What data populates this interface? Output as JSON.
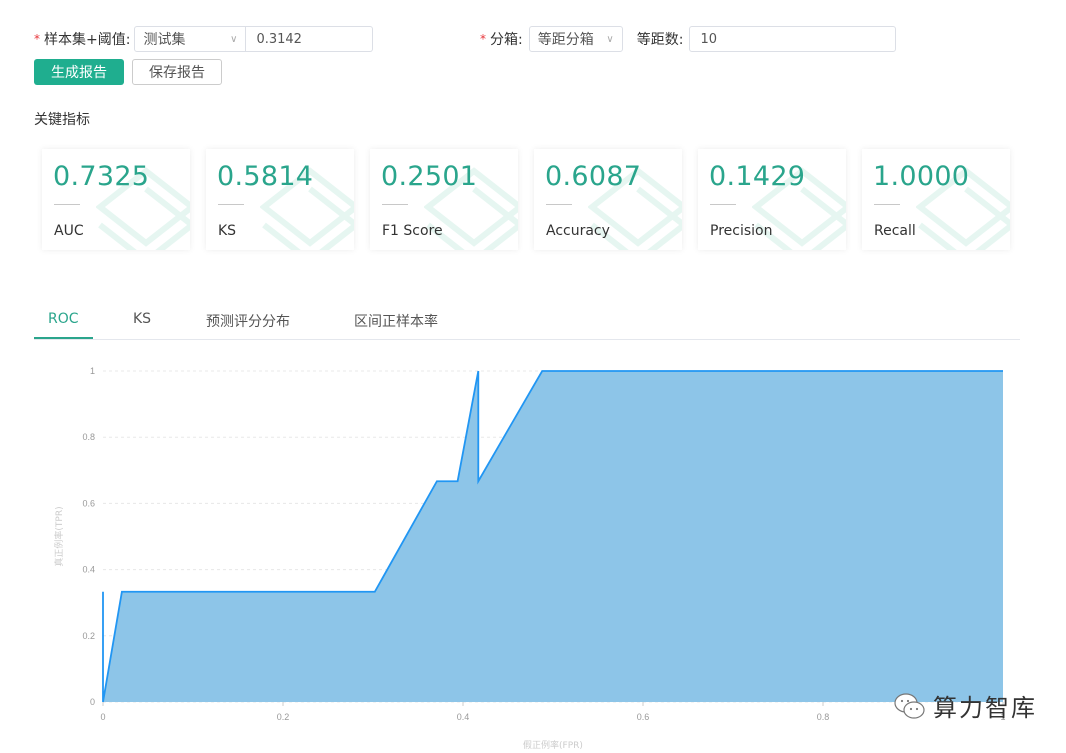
{
  "form": {
    "sample_label": "样本集+阈值:",
    "sample_select": "测试集",
    "threshold_value": "0.3142",
    "binning_label": "分箱:",
    "binning_select": "等距分箱",
    "bins_label": "等距数:",
    "bins_value": "10",
    "required_mark": "*"
  },
  "buttons": {
    "generate": "生成报告",
    "save": "保存报告"
  },
  "metrics_title": "关键指标",
  "metrics": [
    {
      "value": "0.7325",
      "name": "AUC"
    },
    {
      "value": "0.5814",
      "name": "KS"
    },
    {
      "value": "0.2501",
      "name": "F1 Score"
    },
    {
      "value": "0.6087",
      "name": "Accuracy"
    },
    {
      "value": "0.1429",
      "name": "Precision"
    },
    {
      "value": "1.0000",
      "name": "Recall"
    }
  ],
  "tabs": [
    {
      "label": "ROC",
      "active": true
    },
    {
      "label": "KS",
      "active": false
    },
    {
      "label": "预测评分分布",
      "active": false
    },
    {
      "label": "区间正样本率",
      "active": false
    }
  ],
  "colors": {
    "accent": "#2aa58c",
    "primary_button": "#1fae8f",
    "area_fill": "#8dc5e8",
    "line": "#2196f3"
  },
  "watermark": "算力智库",
  "chart_data": {
    "type": "area",
    "title": "",
    "xlabel": "假正例率(FPR)",
    "ylabel": "真正例率(TPR)",
    "xlim": [
      0,
      1
    ],
    "ylim": [
      0,
      1
    ],
    "x_ticks": [
      "0",
      "0.2",
      "0.4",
      "0.6",
      "0.8",
      "1"
    ],
    "y_ticks": [
      "0",
      "0.2",
      "0.4",
      "0.6",
      "0.8",
      "1"
    ],
    "grid": true,
    "series": [
      {
        "name": "ROC",
        "x": [
          0,
          0,
          0,
          0.021,
          0.302,
          0.371,
          0.394,
          0.417,
          0.417,
          0.488,
          1.0
        ],
        "y": [
          0,
          0.333,
          0,
          0.333,
          0.333,
          0.667,
          0.667,
          1.0,
          0.667,
          1.0,
          1.0
        ]
      }
    ]
  }
}
